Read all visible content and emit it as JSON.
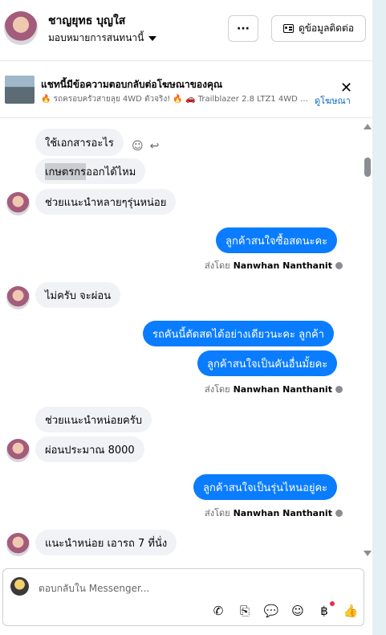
{
  "header": {
    "name": "ชาญยุทธ บุญใส",
    "assign_label": "มอบหมายการสนทนานี้",
    "more_label": "···",
    "contact_label": "ดูข้อมูลติดต่อ"
  },
  "ad": {
    "title": "แชทนี้มีข้อความตอบกลับต่อโฆษณาของคุณ",
    "subtitle": "🔥 รถครอบครัวสายลุย 4WD ตัวจริง! 🔥 🚗 Trailblazer 2.8 LTZ1 4WD A...",
    "link": "ดูโฆษณา",
    "close": "✕"
  },
  "messages": [
    {
      "dir": "in",
      "text": "ใช้เอกสารอะไร"
    },
    {
      "dir": "in",
      "text_hl": "เกษตรกร",
      "text": "ออกได้ไหม"
    },
    {
      "dir": "in",
      "text": "ช่วยแนะนำหลายๆรุ่นหน่อย"
    },
    {
      "dir": "out",
      "text": "ลูกค้าสนใจซื้อสดนะคะ"
    },
    {
      "dir": "in",
      "text": "ไม่ครับ จะผ่อน"
    },
    {
      "dir": "out",
      "text": "รถคันนี้ตัดสดได้อย่างเดียวนะคะ  ลูกค้า"
    },
    {
      "dir": "out",
      "text": "ลูกค้าสนใจเป็นคันอื่นมั้ยคะ"
    },
    {
      "dir": "in",
      "text": "ช่วยแนะนำหน่อยครับ"
    },
    {
      "dir": "in",
      "text": "ผ่อนประมาณ 8000"
    },
    {
      "dir": "out",
      "text": "ลูกค้าสนใจเป็นรุ่นไหนอยู่คะ"
    },
    {
      "dir": "in",
      "text": "แนะนำหน่อย เอารถ 7 ที่นั่ง"
    }
  ],
  "sent_by": {
    "prefix": "ส่งโดย",
    "name": "Nanwhan Nanthanit"
  },
  "composer": {
    "placeholder": "ตอบกลับใน Messenger..."
  },
  "icons": {
    "react": "smile-icon",
    "reply": "reply-icon",
    "composer_tools": [
      "phone-plus-icon",
      "paperclip-icon",
      "message-bubble-icon",
      "emoji-icon",
      "baht-icon",
      "thumbs-up-icon"
    ]
  },
  "colors": {
    "outgoing": "#0a7cff",
    "incoming": "#f0f2f5",
    "link": "#0a66c2"
  }
}
